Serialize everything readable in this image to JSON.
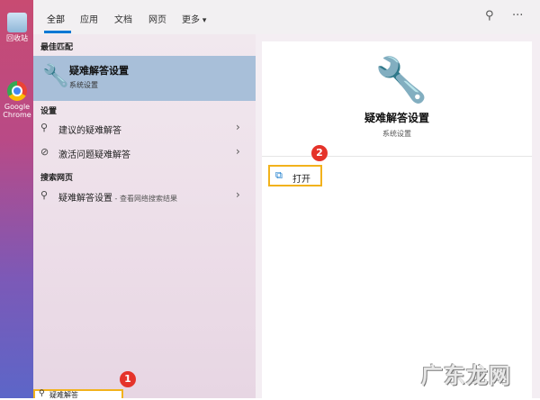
{
  "desktop": {
    "recycle_label": "回收站",
    "chrome_label": "Google Chrome"
  },
  "tabs": [
    {
      "label": "全部",
      "active": true
    },
    {
      "label": "应用"
    },
    {
      "label": "文档"
    },
    {
      "label": "网页"
    },
    {
      "label": "更多"
    }
  ],
  "toolbar": {
    "feedback_icon": "feedback-icon",
    "more_icon": "···"
  },
  "left": {
    "best_match_header": "最佳匹配",
    "best_match": {
      "title": "疑难解答设置",
      "subtitle": "系统设置",
      "icon": "wrench-icon"
    },
    "settings_header": "设置",
    "settings_items": [
      {
        "label": "建议的疑难解答",
        "icon": "feedback-icon"
      },
      {
        "label": "激活问题疑难解答",
        "icon": "check-circle-icon"
      }
    ],
    "web_header": "搜索网页",
    "web_items": [
      {
        "label": "疑难解答设置",
        "sub": " - 查看网络搜索结果",
        "icon": "search-icon"
      }
    ]
  },
  "right": {
    "title": "疑难解答设置",
    "subtitle": "系统设置",
    "open_label": "打开"
  },
  "badges": {
    "one": "1",
    "two": "2"
  },
  "search": {
    "value": "疑难解答"
  },
  "watermark": "广东龙网",
  "colors": {
    "accent": "#0078d4",
    "highlight": "#f2b21c",
    "badge": "#e5332a",
    "selected": "#a8bfd9"
  }
}
